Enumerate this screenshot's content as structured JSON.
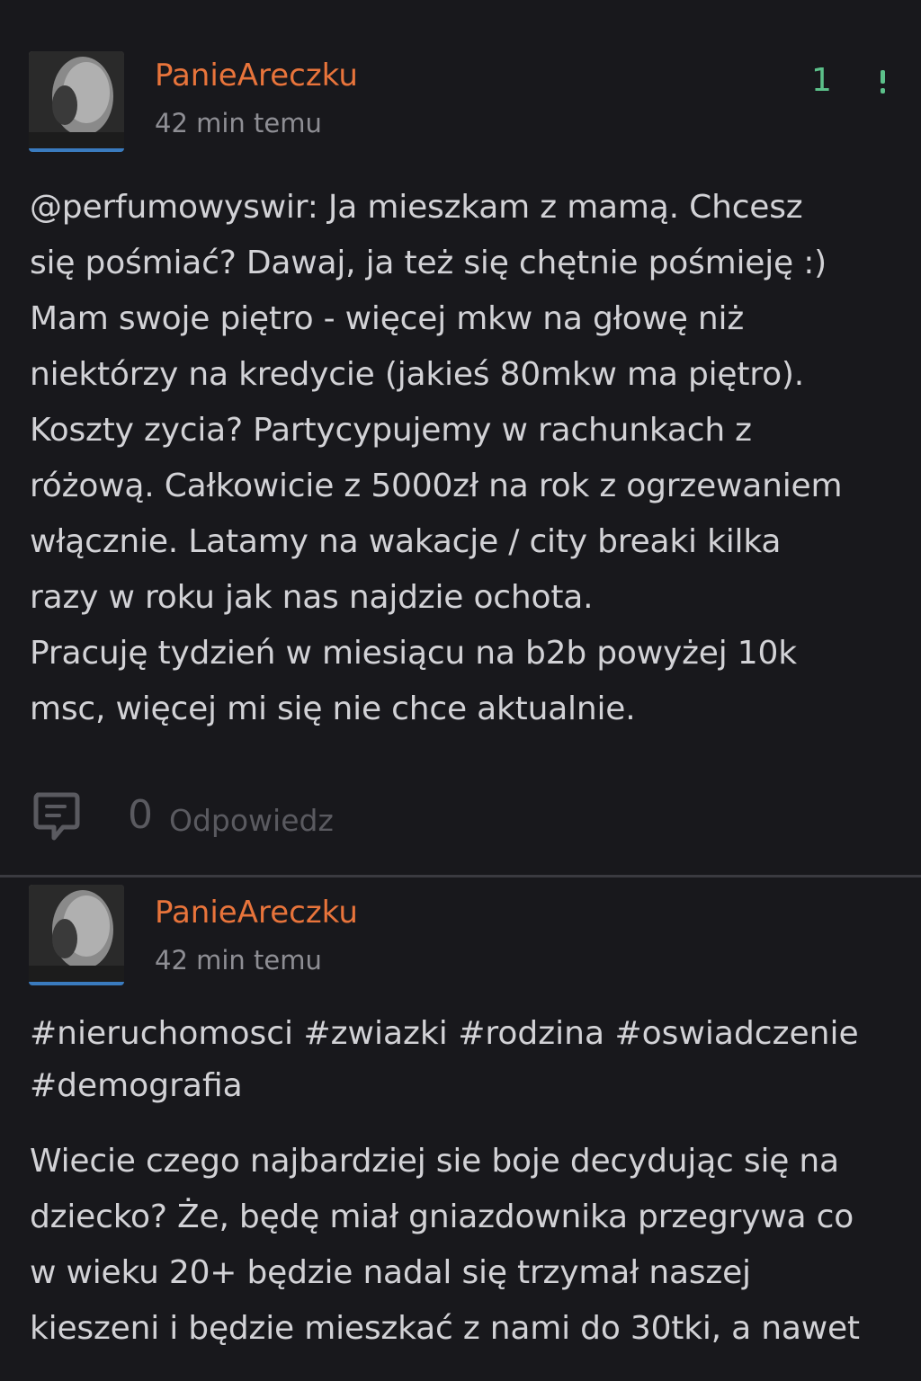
{
  "posts": [
    {
      "username": "PanieAreczku",
      "timestamp": "42 min temu",
      "votes": "1",
      "body": "@perfumowyswir: Ja mieszkam z mamą. Chcesz\nsię pośmiać? Dawaj, ja też się chętnie pośmieję :)\nMam swoje piętro - więcej mkw na głowę niż\nniektórzy na kredycie (jakieś 80mkw ma piętro).\nKoszty zycia? Partycypujemy w rachunkach z\nróżową. Całkowicie z 5000zł na rok z ogrzewaniem\nwłącznie. Latamy na wakacje / city breaki kilka\nrazy w roku jak nas najdzie ochota.\nPracuję tydzień w miesiącu na b2b powyżej 10k\nmsc, więcej mi się nie chce aktualnie.",
      "reply_count": "0",
      "reply_label": "Odpowiedz"
    },
    {
      "username": "PanieAreczku",
      "timestamp": "42 min temu",
      "tags": "#nieruchomosci #zwiazki #rodzina #oswiadczenie\n#demografia",
      "body": "Wiecie czego najbardziej sie boje decydując się na\ndziecko? Że, będę miał gniazdownika przegrywa co\nw wieku 20+ będzie nadal się trzymał naszej\nkieszeni i będzie mieszkać z nami do 30tki, a nawet"
    }
  ],
  "icons": {
    "more": "more-vertical-icon",
    "comment": "comment-icon"
  },
  "colors": {
    "background": "#18181c",
    "username": "#e8743b",
    "vote": "#5cc08a",
    "avatar_border": "#3a7bbf"
  }
}
